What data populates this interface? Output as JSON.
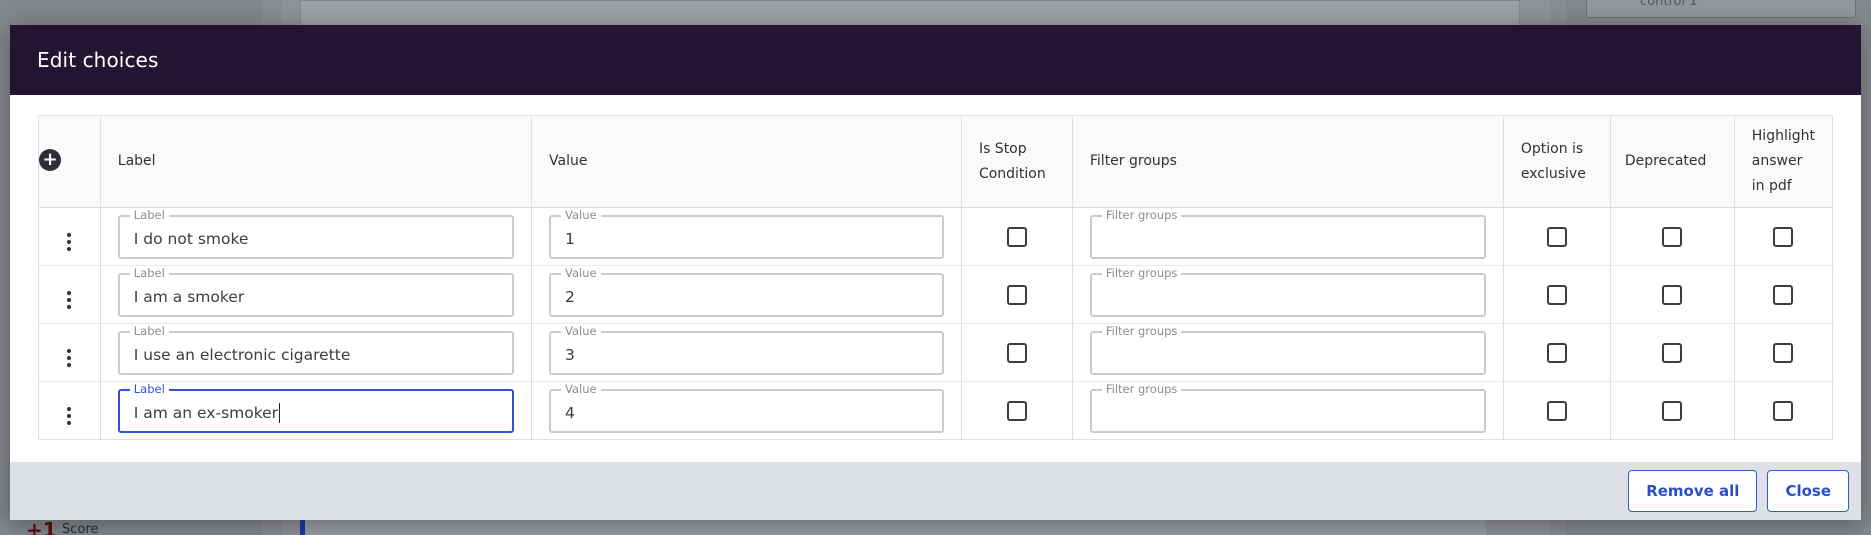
{
  "backdrop": {
    "right_panel_text": "control 1",
    "score_value": "+1",
    "score_label": "Score"
  },
  "modal": {
    "title": "Edit choices",
    "columns": {
      "label": "Label",
      "value": "Value",
      "is_stop_line1": "Is Stop",
      "is_stop_line2": "Condition",
      "filter_groups": "Filter groups",
      "exclusive_line1": "Option is",
      "exclusive_line2": "exclusive",
      "deprecated": "Deprecated",
      "highlight_line1": "Highlight",
      "highlight_line2": "answer",
      "highlight_line3": "in pdf"
    },
    "field_labels": {
      "label": "Label",
      "value": "Value",
      "filter_groups": "Filter groups"
    },
    "rows": [
      {
        "label": "I do not smoke",
        "value": "1",
        "filter_groups": "",
        "is_stop": false,
        "exclusive": false,
        "deprecated": false,
        "highlight": false
      },
      {
        "label": "I am a smoker",
        "value": "2",
        "filter_groups": "",
        "is_stop": false,
        "exclusive": false,
        "deprecated": false,
        "highlight": false
      },
      {
        "label": "I use an electronic cigarette",
        "value": "3",
        "filter_groups": "",
        "is_stop": false,
        "exclusive": false,
        "deprecated": false,
        "highlight": false
      },
      {
        "label": "I am an ex-smoker",
        "value": "4",
        "filter_groups": "",
        "is_stop": false,
        "exclusive": false,
        "deprecated": false,
        "highlight": false
      }
    ],
    "footer": {
      "remove_all_label": "Remove all",
      "close_label": "Close"
    }
  },
  "colors": {
    "header_bg": "#231432",
    "accent": "#2f55d4",
    "footer_bg": "#dde1e6"
  },
  "icons": {
    "add": "plus-circle-icon",
    "row_menu": "kebab-menu-icon"
  }
}
